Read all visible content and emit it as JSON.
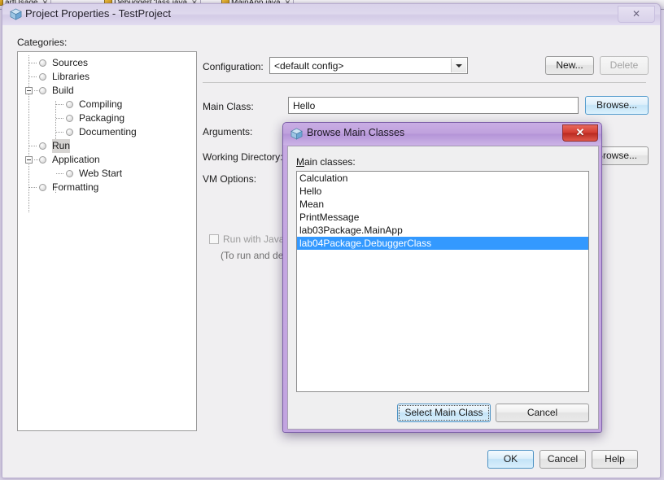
{
  "ide_tabs": [
    {
      "label": "artUsage",
      "close": "✕",
      "icon": "java-file-icon"
    },
    {
      "label": "DebuggerClass.java",
      "close": "✕",
      "icon": "java-file-icon"
    },
    {
      "label": "MainApp.java",
      "close": "✕",
      "icon": "java-file-icon"
    }
  ],
  "window": {
    "title": "Project Properties - TestProject",
    "icon": "netbeans-cube-icon",
    "close_label": "✕"
  },
  "categories": {
    "label": "Categories:",
    "items": [
      {
        "label": "Sources",
        "indent": 0,
        "expander": "none",
        "selected": false
      },
      {
        "label": "Libraries",
        "indent": 0,
        "expander": "none",
        "selected": false
      },
      {
        "label": "Build",
        "indent": 0,
        "expander": "collapse",
        "selected": false
      },
      {
        "label": "Compiling",
        "indent": 1,
        "expander": "none",
        "selected": false
      },
      {
        "label": "Packaging",
        "indent": 1,
        "expander": "none",
        "selected": false
      },
      {
        "label": "Documenting",
        "indent": 1,
        "expander": "none",
        "selected": false
      },
      {
        "label": "Run",
        "indent": 0,
        "expander": "none",
        "selected": true
      },
      {
        "label": "Application",
        "indent": 0,
        "expander": "collapse",
        "selected": false
      },
      {
        "label": "Web Start",
        "indent": 1,
        "expander": "none",
        "selected": false
      },
      {
        "label": "Formatting",
        "indent": 0,
        "expander": "none",
        "selected": false
      }
    ]
  },
  "run_panel": {
    "configuration_label": "Configuration:",
    "configuration_value": "<default config>",
    "new_button": "New...",
    "delete_button": "Delete",
    "main_class_label": "Main Class:",
    "main_class_value": "Hello",
    "main_class_browse": "Browse...",
    "arguments_label": "Arguments:",
    "arguments_value": "",
    "working_directory_label": "Working Directory:",
    "working_directory_value": "",
    "working_directory_browse": "Browse...",
    "vm_options_label": "VM Options:",
    "vm_options_value": "",
    "web_start_checkbox_label": "Run with Java W",
    "hint_text": "(To run and debug"
  },
  "footer": {
    "ok": "OK",
    "cancel": "Cancel",
    "help": "Help"
  },
  "dialog": {
    "title": "Browse Main Classes",
    "icon": "netbeans-cube-icon",
    "close_label": "✕",
    "list_label_mnemonic": "M",
    "list_label_rest": "ain classes:",
    "classes": [
      {
        "name": "Calculation",
        "selected": false
      },
      {
        "name": "Hello",
        "selected": false
      },
      {
        "name": "Mean",
        "selected": false
      },
      {
        "name": "PrintMessage",
        "selected": false
      },
      {
        "name": "lab03Package.MainApp",
        "selected": false
      },
      {
        "name": "lab04Package.DebuggerClass",
        "selected": true
      }
    ],
    "select_button": "Select Main Class",
    "cancel_button": "Cancel"
  },
  "colors": {
    "selection_blue": "#3399ff",
    "title_purple": "#c2a4e0",
    "close_red": "#d23c31",
    "window_lavender": "#d9d2ea"
  }
}
